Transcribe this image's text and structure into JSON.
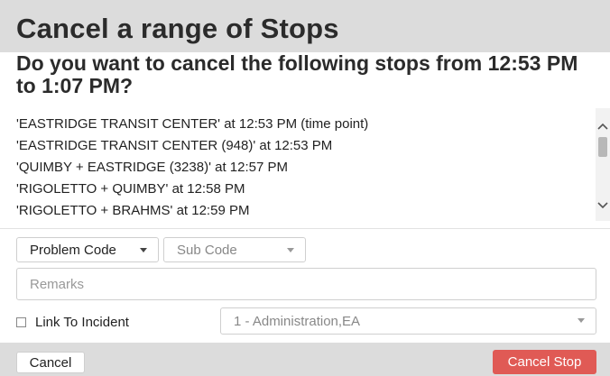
{
  "dialog": {
    "title": "Cancel a range of Stops",
    "question": "Do you want to cancel the following stops from 12:53 PM to 1:07 PM?"
  },
  "stops": [
    "'EASTRIDGE TRANSIT CENTER' at 12:53 PM (time point)",
    "'EASTRIDGE TRANSIT CENTER (948)' at 12:53 PM",
    "'QUIMBY + EASTRIDGE (3238)' at 12:57 PM",
    "'RIGOLETTO + QUIMBY' at 12:58 PM",
    "'RIGOLETTO + BRAHMS' at 12:59 PM"
  ],
  "form": {
    "problem_code_label": "Problem Code",
    "sub_code_label": "Sub Code",
    "remarks_placeholder": "Remarks",
    "link_to_incident_label": "Link To Incident",
    "incident_value": "1 - Administration,EA"
  },
  "footer": {
    "cancel_label": "Cancel",
    "cancel_stop_label": "Cancel Stop"
  },
  "colors": {
    "header_bg": "#dcdcdc",
    "danger": "#e05a55"
  },
  "icons": {
    "scroll_up": "chevron-up-icon",
    "scroll_down": "chevron-down-icon",
    "dropdown": "caret-down-icon"
  }
}
